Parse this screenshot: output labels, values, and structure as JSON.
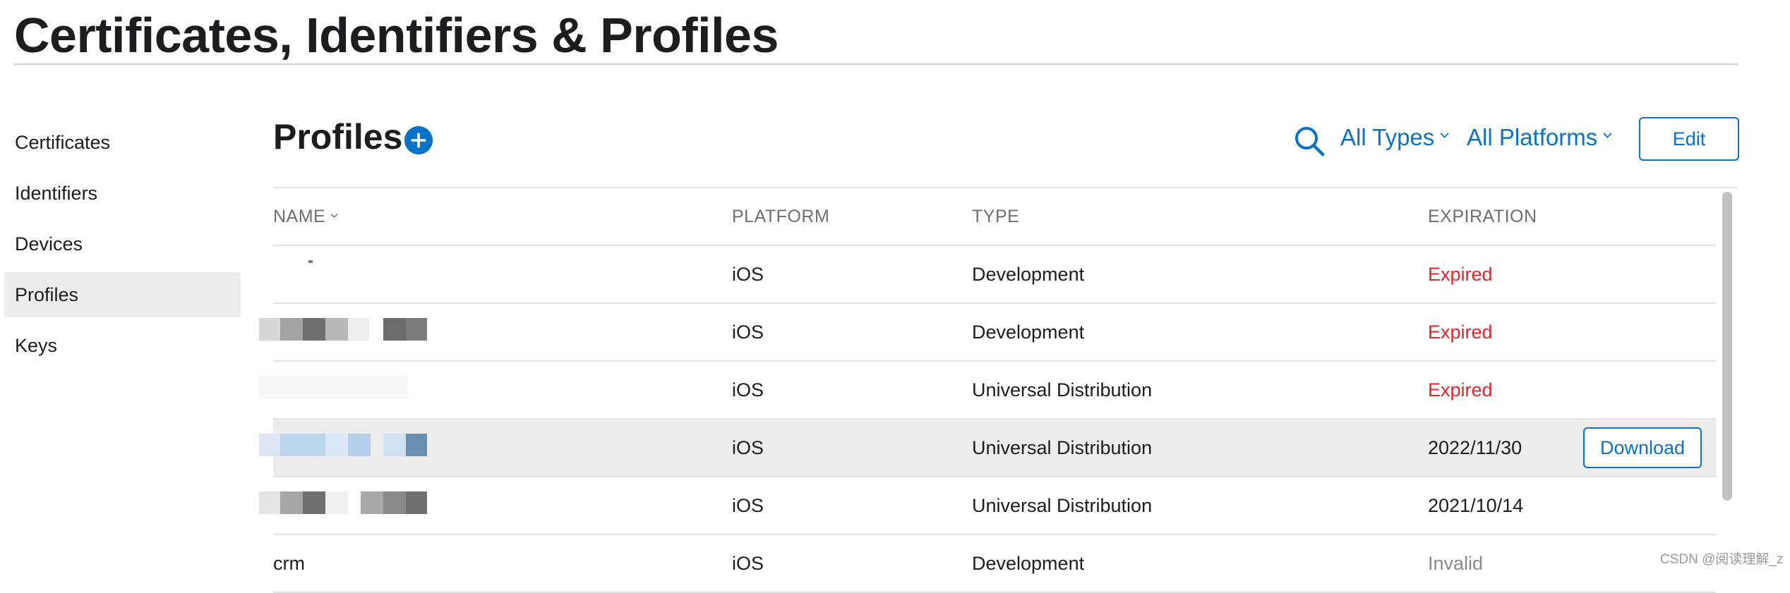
{
  "page": {
    "title": "Certificates, Identifiers & Profiles"
  },
  "sidebar": {
    "items": [
      {
        "label": "Certificates",
        "active": false
      },
      {
        "label": "Identifiers",
        "active": false
      },
      {
        "label": "Devices",
        "active": false
      },
      {
        "label": "Profiles",
        "active": true
      },
      {
        "label": "Keys",
        "active": false
      }
    ]
  },
  "main": {
    "section_title": "Profiles",
    "add_icon": "plus-circle-icon",
    "search_icon": "search-icon",
    "filters": {
      "types": "All Types",
      "platforms": "All Platforms"
    },
    "edit_label": "Edit"
  },
  "table": {
    "columns": [
      "NAME",
      "PLATFORM",
      "TYPE",
      "EXPIRATION"
    ],
    "rows": [
      {
        "name": "",
        "platform": "iOS",
        "type": "Development",
        "expiration": "Expired",
        "status": "expired"
      },
      {
        "name": "",
        "platform": "iOS",
        "type": "Development",
        "expiration": "Expired",
        "status": "expired"
      },
      {
        "name": "",
        "platform": "iOS",
        "type": "Universal Distribution",
        "expiration": "Expired",
        "status": "expired"
      },
      {
        "name": "",
        "platform": "iOS",
        "type": "Universal Distribution",
        "expiration": "2022/11/30",
        "status": "valid",
        "download_label": "Download"
      },
      {
        "name": "",
        "platform": "iOS",
        "type": "Universal Distribution",
        "expiration": "2021/10/14",
        "status": "valid"
      },
      {
        "name": "crm",
        "platform": "iOS",
        "type": "Development",
        "expiration": "Invalid",
        "status": "invalid"
      }
    ]
  },
  "colors": {
    "accent": "#0a72c9",
    "expired": "#e0262a",
    "invalid": "#8a8a8e",
    "selected_row": "#ececec"
  },
  "watermark": "CSDN @阅读理解_z"
}
